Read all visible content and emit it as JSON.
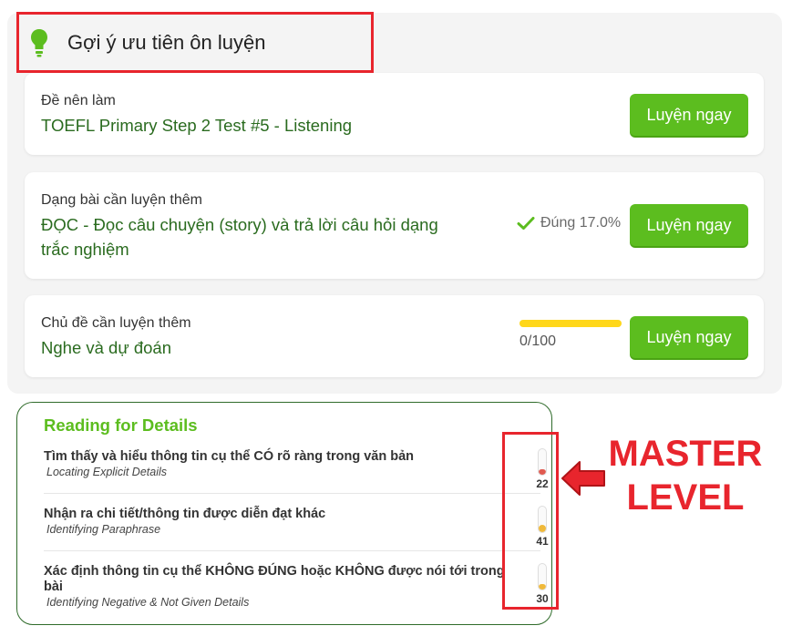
{
  "header": {
    "title": "Gợi ý ưu tiên ôn luyện",
    "icon": "lightbulb-icon",
    "icon_color": "#5cbd1f"
  },
  "cards": [
    {
      "label": "Đề nên làm",
      "value": "TOEFL Primary Step 2 Test #5 - Listening",
      "button": "Luyện ngay"
    },
    {
      "label": "Dạng bài cần luyện thêm",
      "value_line1": "ĐỌC - Đọc câu chuyện (story) và trả lời câu hỏi dạng",
      "value_line2": "trắc nghiệm",
      "accuracy": "Đúng 17.0%",
      "button": "Luyện ngay"
    },
    {
      "label": "Chủ đề cần luyện thêm",
      "value": "Nghe và dự đoán",
      "progress_text": "0/100",
      "progress_fraction": 1.0,
      "button": "Luyện ngay"
    }
  ],
  "reading": {
    "title": "Reading for Details",
    "rows": [
      {
        "title": "Tìm thấy và hiểu thông tin cụ thể CÓ rõ ràng trong văn bản",
        "subtitle": "Locating Explicit Details",
        "level": "22",
        "level_fraction": 0.22,
        "color": "#e05a50"
      },
      {
        "title": "Nhận ra chi tiết/thông tin được diễn đạt khác",
        "subtitle": "Identifying Paraphrase",
        "level": "41",
        "level_fraction": 0.3,
        "color": "#f0b93a"
      },
      {
        "title_line1": "Xác định thông tin cụ thể KHÔNG ĐÚNG hoặc KHÔNG được nói tới trong",
        "title_line2": "bài",
        "subtitle": "Identifying Negative & Not Given Details",
        "level": "30",
        "level_fraction": 0.22,
        "color": "#f0b93a"
      }
    ]
  },
  "annotation": {
    "line1": "MASTER",
    "line2": "LEVEL",
    "color": "#e8252d"
  }
}
